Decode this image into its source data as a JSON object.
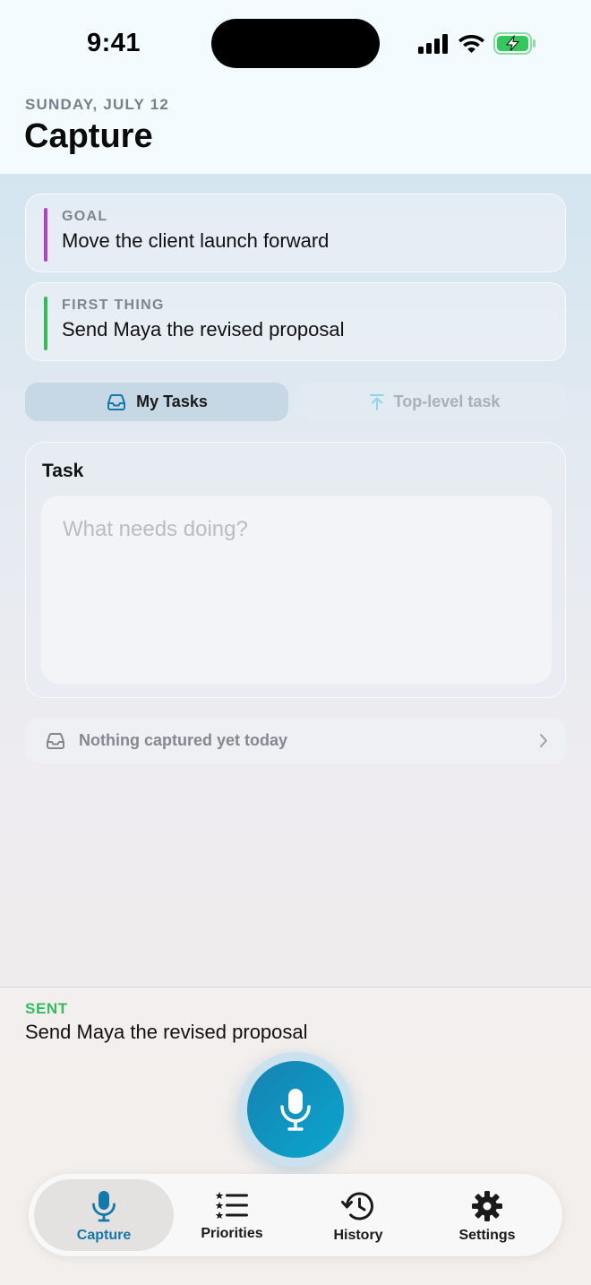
{
  "status_bar": {
    "time": "9:41",
    "icons": [
      "cellular-signal-icon",
      "wifi-icon",
      "battery-charging-icon"
    ],
    "battery_color": "#34c759"
  },
  "header": {
    "date": "SUNDAY, JULY 12",
    "title": "Capture"
  },
  "goal_card": {
    "label": "GOAL",
    "value": "Move the client launch forward",
    "accent_color": "#b23fdc"
  },
  "first_thing_card": {
    "label": "FIRST THING",
    "value": "Send Maya the revised proposal",
    "accent_color": "#2fbf5a"
  },
  "destination_toggle": {
    "options": [
      {
        "label": "My Tasks",
        "icon": "inbox-tray-icon",
        "selected": true
      },
      {
        "label": "Top-level task",
        "icon": "arrow-up-to-line-icon",
        "selected": false
      }
    ]
  },
  "task_form": {
    "label": "Task",
    "input_value": "",
    "placeholder": "What needs doing?"
  },
  "captured_summary": {
    "icon": "inbox-tray-icon",
    "text": "Nothing captured yet today"
  },
  "sent": {
    "label": "SENT",
    "text": "Send Maya the revised proposal",
    "label_color": "#2fbf5a"
  },
  "record_button": {
    "icon": "microphone-icon",
    "color": "#0f93c0"
  },
  "tab_bar": {
    "active_color": "#1478a8",
    "tabs": [
      {
        "label": "Capture",
        "icon": "microphone-icon",
        "active": true
      },
      {
        "label": "Priorities",
        "icon": "starred-list-icon",
        "active": false
      },
      {
        "label": "History",
        "icon": "history-clock-icon",
        "active": false
      },
      {
        "label": "Settings",
        "icon": "gear-icon",
        "active": false
      }
    ]
  }
}
